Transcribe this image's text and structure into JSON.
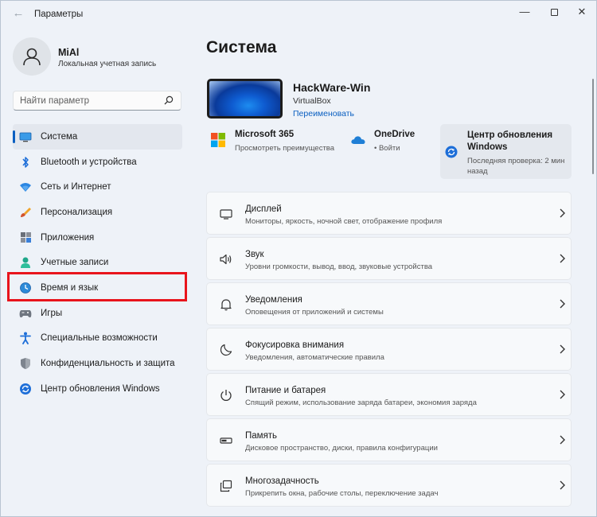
{
  "window": {
    "title": "Параметры",
    "back_glyph": "←",
    "minimize_glyph": "—",
    "close_glyph": "✕"
  },
  "profile": {
    "name": "MiAl",
    "account_type": "Локальная учетная запись",
    "avatar_icon": "user-icon"
  },
  "search": {
    "placeholder": "Найти параметр",
    "icon": "search-icon"
  },
  "sidebar": {
    "items": [
      {
        "label": "Система",
        "icon": "monitor-icon",
        "active": true
      },
      {
        "label": "Bluetooth и устройства",
        "icon": "bluetooth-icon"
      },
      {
        "label": "Сеть и Интернет",
        "icon": "wifi-icon"
      },
      {
        "label": "Персонализация",
        "icon": "brush-icon"
      },
      {
        "label": "Приложения",
        "icon": "apps-icon"
      },
      {
        "label": "Учетные записи",
        "icon": "account-icon"
      },
      {
        "label": "Время и язык",
        "icon": "globe-clock-icon",
        "highlighted": true
      },
      {
        "label": "Игры",
        "icon": "gamepad-icon"
      },
      {
        "label": "Специальные возможности",
        "icon": "accessibility-icon"
      },
      {
        "label": "Конфиденциальность и защита",
        "icon": "shield-icon"
      },
      {
        "label": "Центр обновления Windows",
        "icon": "update-icon"
      }
    ]
  },
  "main": {
    "title": "Система",
    "device": {
      "name": "HackWare-Win",
      "subtitle": "VirtualBox",
      "rename_link": "Переименовать"
    },
    "quick": {
      "ms365": {
        "title": "Microsoft 365",
        "subtitle": "Просмотреть преимущества"
      },
      "onedrive": {
        "title": "OneDrive",
        "subtitle": "• Войти"
      },
      "update": {
        "title": "Центр обновления Windows",
        "subtitle": "Последняя проверка: 2 мин назад"
      }
    },
    "settings": [
      {
        "title": "Дисплей",
        "subtitle": "Мониторы, яркость, ночной свет, отображение профиля",
        "icon": "display-icon"
      },
      {
        "title": "Звук",
        "subtitle": "Уровни громкости, вывод, ввод, звуковые устройства",
        "icon": "speaker-icon"
      },
      {
        "title": "Уведомления",
        "subtitle": "Оповещения от приложений и системы",
        "icon": "bell-icon"
      },
      {
        "title": "Фокусировка внимания",
        "subtitle": "Уведомления, автоматические правила",
        "icon": "moon-icon"
      },
      {
        "title": "Питание и батарея",
        "subtitle": "Спящий режим, использование заряда батареи, экономия заряда",
        "icon": "power-icon"
      },
      {
        "title": "Память",
        "subtitle": "Дисковое пространство, диски, правила конфигурации",
        "icon": "storage-icon"
      },
      {
        "title": "Многозадачность",
        "subtitle": "Прикрепить окна, рабочие столы, переключение задач",
        "icon": "multitask-icon"
      }
    ]
  },
  "colors": {
    "accent": "#0a5fc1",
    "highlight": "#e8141c",
    "background": "#eef2f8",
    "card": "#f7f9fb"
  }
}
